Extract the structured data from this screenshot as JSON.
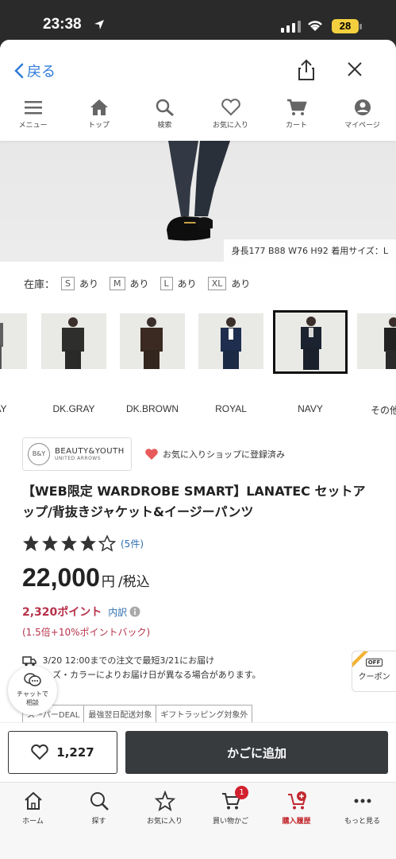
{
  "status": {
    "time": "23:38",
    "battery": "28"
  },
  "topbar": {
    "back_label": "戻る"
  },
  "nav": [
    {
      "label": "メニュー",
      "icon": "menu-icon"
    },
    {
      "label": "トップ",
      "icon": "home-icon"
    },
    {
      "label": "検索",
      "icon": "search-icon"
    },
    {
      "label": "お気に入り",
      "icon": "heart-icon"
    },
    {
      "label": "カート",
      "icon": "cart-icon"
    },
    {
      "label": "マイページ",
      "icon": "user-icon"
    }
  ],
  "hero": {
    "caption": "身長177 B88 W76 H92 着用サイズ：L"
  },
  "stock": {
    "label": "在庫：",
    "sizes": [
      {
        "size": "S",
        "status": "あり"
      },
      {
        "size": "M",
        "status": "あり"
      },
      {
        "size": "L",
        "status": "あり"
      },
      {
        "size": "XL",
        "status": "あり"
      }
    ]
  },
  "swatches": [
    {
      "label": "GRAY",
      "color": "#5f5f5f"
    },
    {
      "label": "DK.GRAY",
      "color": "#2e2e2c"
    },
    {
      "label": "DK.BROWN",
      "color": "#3a2a22"
    },
    {
      "label": "ROYAL",
      "color": "#1f2e4e"
    },
    {
      "label": "NAVY",
      "color": "#1c2330",
      "selected": true
    },
    {
      "label": "その他",
      "color": "#222222"
    }
  ],
  "brand": {
    "name": "BEAUTY&YOUTH",
    "sub": "UNITED ARROWS",
    "logo": "B&Y",
    "fav_shop": "お気に入りショップに登録済み"
  },
  "product": {
    "title": "【WEB限定 WARDROBE SMART】LANATEC セットアップ/背抜きジャケット&イージーパンツ",
    "rating": 4,
    "review_count": "(5件)",
    "price": "22,000",
    "yen": "円",
    "tax": "/税込",
    "points": "2,320ポイント",
    "points_detail": "内訳",
    "point_back": "(1.5倍+10%ポイントバック)",
    "delivery_line1": "3/20 12:00までの注文で最短3/21にお届け",
    "delivery_line2": "ズ・カラーによりお届け日が異なる場合があります。",
    "tags": [
      "スーパーDEAL",
      "最強翌日配送対象",
      "ギフトラッピング対象外"
    ]
  },
  "chat": {
    "line1": "チャットで",
    "line2": "相談"
  },
  "coupon": {
    "tag": "OFF",
    "label": "クーポン"
  },
  "actions": {
    "like_count": "1,227",
    "cart_label": "かごに追加"
  },
  "tabs": [
    {
      "label": "ホーム",
      "icon": "home-icon"
    },
    {
      "label": "探す",
      "icon": "search-icon"
    },
    {
      "label": "お気に入り",
      "icon": "star-icon"
    },
    {
      "label": "買い物かご",
      "icon": "cart-icon",
      "badge": "1"
    },
    {
      "label": "購入履歴",
      "icon": "purchase-history-icon",
      "active": true
    },
    {
      "label": "もっと見る",
      "icon": "more-icon"
    }
  ],
  "colors": {
    "accent_blue": "#2f7bd9",
    "points_red": "#b8324a",
    "button_dark": "#383b3e",
    "active_tab": "#c1272d"
  }
}
